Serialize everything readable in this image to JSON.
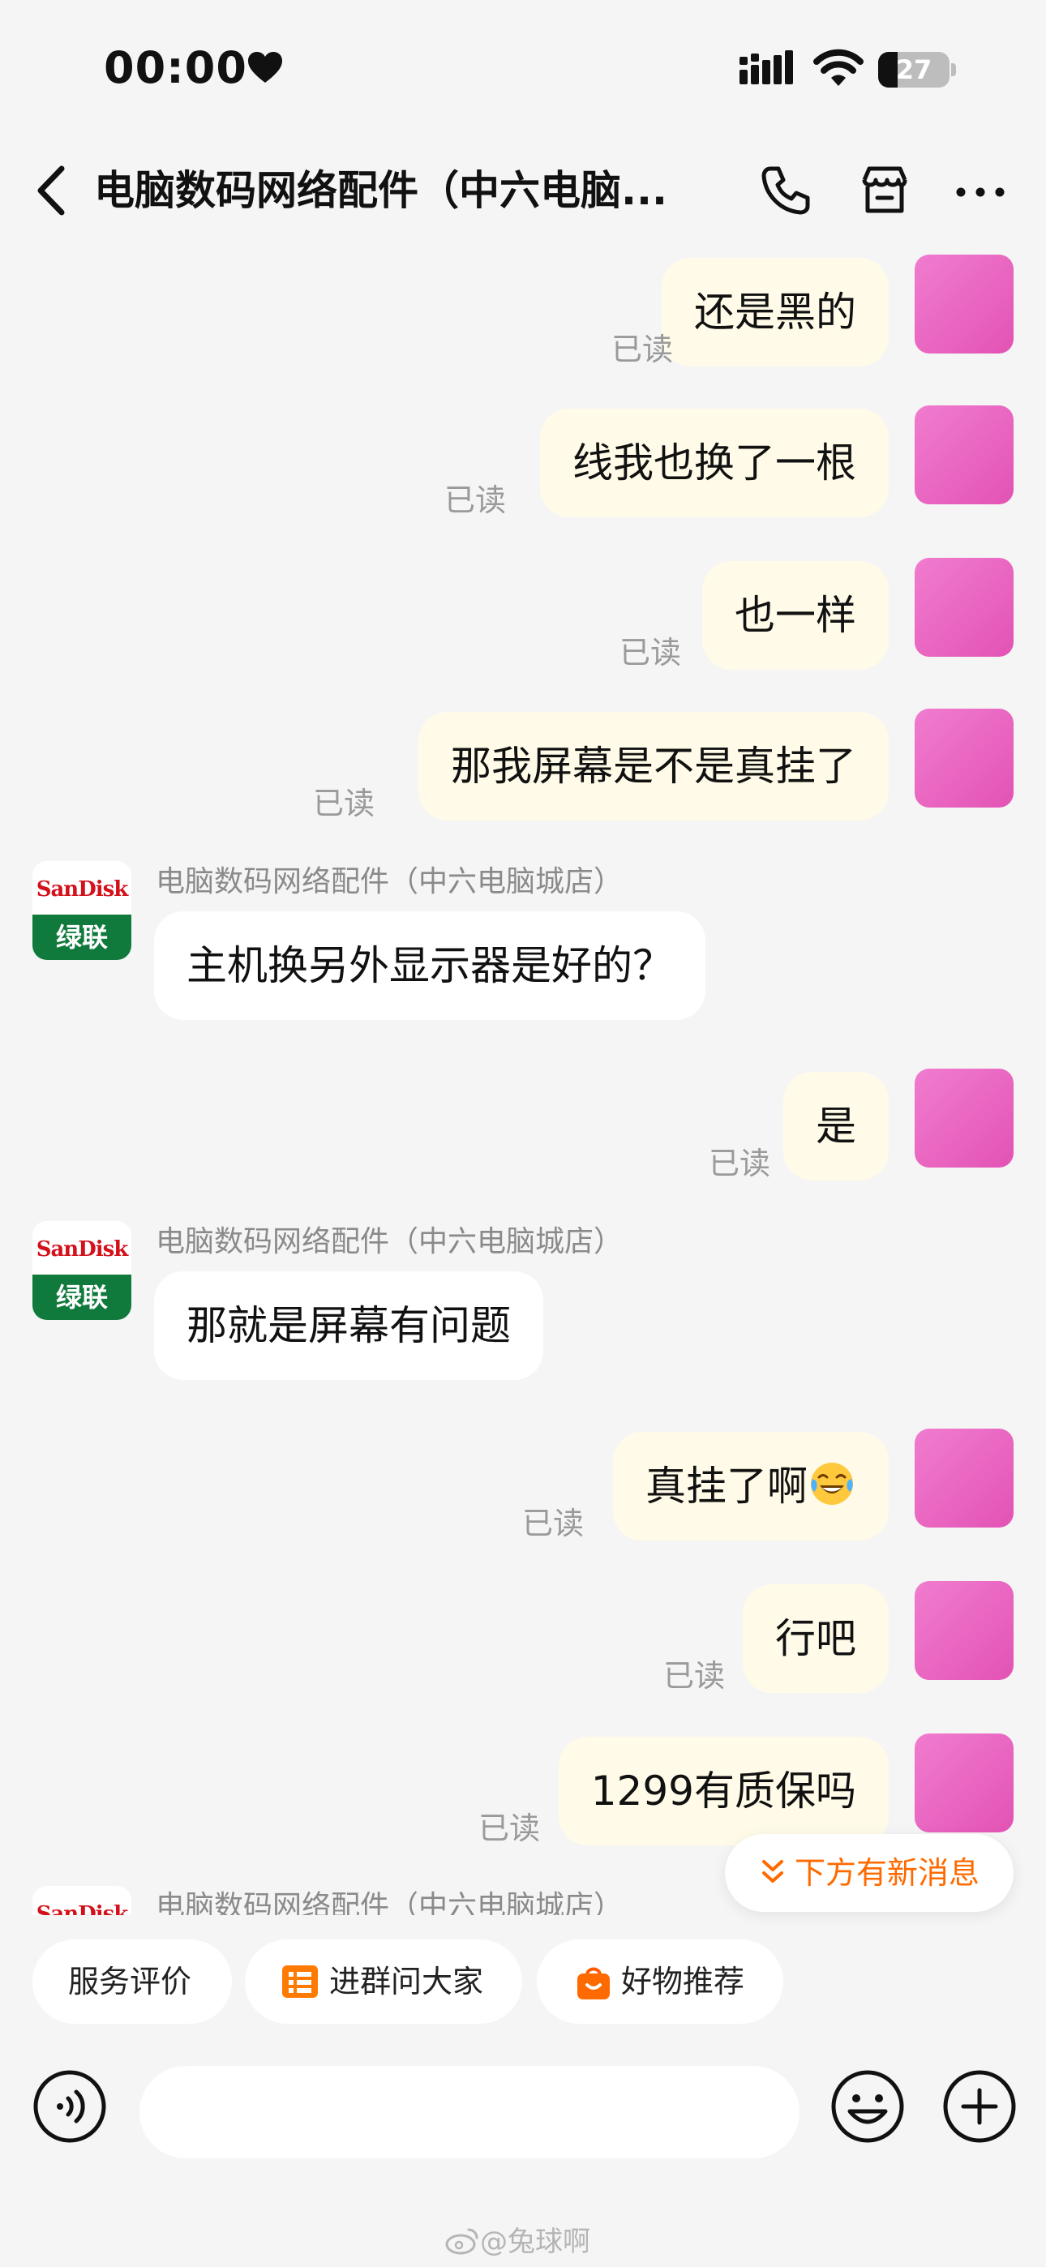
{
  "status_bar": {
    "time": "00:00",
    "battery": "27",
    "battery_level": 0.27
  },
  "nav": {
    "title": "电脑数码网络配件（中六电脑..."
  },
  "read_label": "已读",
  "shop_name": "电脑数码网络配件（中六电脑城店）",
  "shop_avatar": {
    "brand": "SanDisk",
    "name": "绿联"
  },
  "messages": [
    {
      "from": "me",
      "text": "还是黑的",
      "status": "已读"
    },
    {
      "from": "me",
      "text": "线我也换了一根",
      "status": "已读"
    },
    {
      "from": "me",
      "text": "也一样",
      "status": "已读"
    },
    {
      "from": "me",
      "text": "那我屏幕是不是真挂了",
      "status": "已读"
    },
    {
      "from": "shop",
      "sender": "电脑数码网络配件（中六电脑城店）",
      "text": "主机换另外显示器是好的？"
    },
    {
      "from": "me",
      "text": "是",
      "status": "已读"
    },
    {
      "from": "shop",
      "sender": "电脑数码网络配件（中六电脑城店）",
      "text": "那就是屏幕有问题"
    },
    {
      "from": "me",
      "text": "真挂了啊",
      "emoji": "laughing-crying",
      "status": "已读"
    },
    {
      "from": "me",
      "text": "行吧",
      "status": "已读"
    },
    {
      "from": "me",
      "text": "1299有质保吗",
      "status": "已读"
    },
    {
      "from": "shop",
      "sender": "电脑数码网络配件（中六电脑城店）",
      "text": ""
    }
  ],
  "new_message_pill": {
    "label": "下方有新消息"
  },
  "chips": [
    {
      "label": "服务评价",
      "icon": ""
    },
    {
      "label": "进群问大家",
      "icon": "group-icon"
    },
    {
      "label": "好物推荐",
      "icon": "shopping-bag-icon"
    }
  ],
  "input": {
    "value": "",
    "placeholder": ""
  },
  "watermark": "@兔球啊",
  "colors": {
    "accent": "#ff6a00",
    "my_bubble": "#fffbe8",
    "background": "#f5f5f5"
  }
}
